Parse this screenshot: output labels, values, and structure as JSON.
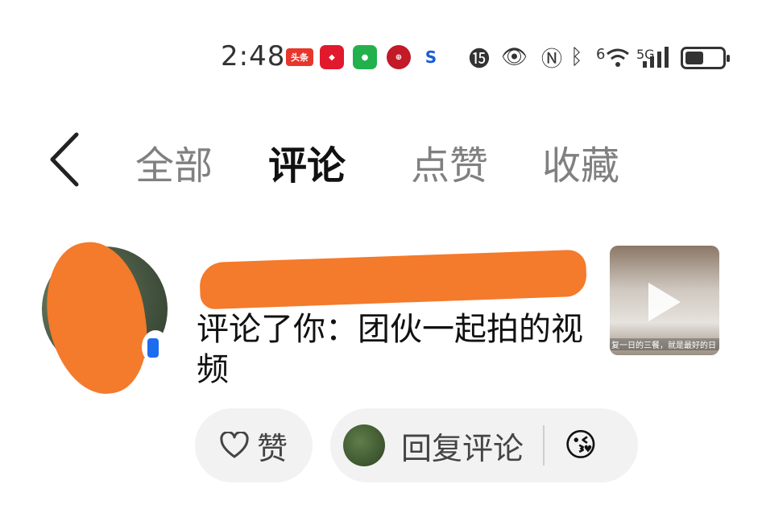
{
  "status_bar": {
    "time": "2:48",
    "app_icons": [
      "toutiao-icon",
      "red-app-icon",
      "green-app-icon",
      "bank-icon",
      "s-app-icon"
    ],
    "toutiao_label": "头条",
    "signal_label": "5G",
    "wifi_label": "6",
    "battery_level": 0.5
  },
  "nav": {
    "tabs": [
      {
        "label": "全部"
      },
      {
        "label": "评论"
      },
      {
        "label": "点赞"
      },
      {
        "label": "收藏"
      }
    ],
    "active_tab": "评论"
  },
  "notification": {
    "comment_text": "评论了你：团伙一起拍的视频",
    "thumbnail_caption": "复一日的三餐，就是最好的日"
  },
  "actions": {
    "like_label": "赞",
    "reply_label": "回复评论",
    "emoji": "😘"
  },
  "colors": {
    "redaction": "#f47a2c",
    "chip_bg": "#f2f2f2",
    "active_tab": "#111111",
    "inactive_tab": "#808080"
  }
}
